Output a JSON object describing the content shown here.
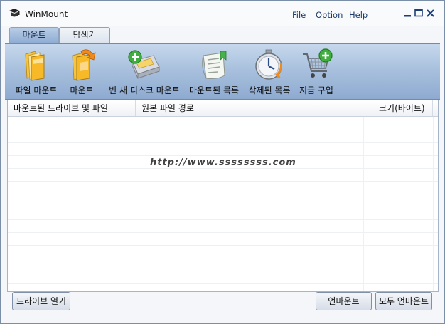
{
  "window": {
    "title": "WinMount"
  },
  "menu": [
    {
      "label": "File"
    },
    {
      "label": "Option"
    },
    {
      "label": "Help"
    }
  ],
  "tabs": [
    {
      "label": "마운트",
      "active": true
    },
    {
      "label": "탐색기",
      "active": false
    }
  ],
  "toolbar": {
    "items": [
      {
        "label": "파일 마운트",
        "icon": "folder-mount-icon"
      },
      {
        "label": "마운트",
        "icon": "folder-orange-arrow-icon"
      },
      {
        "label": "빈 새 디스크 마운트",
        "icon": "new-disk-add-icon"
      },
      {
        "label": "마운트된 목록",
        "icon": "mounted-list-icon"
      },
      {
        "label": "삭제된 목록",
        "icon": "deleted-list-clock-icon"
      },
      {
        "label": "지금 구입",
        "icon": "shopping-cart-icon"
      }
    ]
  },
  "list": {
    "columns": [
      {
        "label": "마운트된 드라이브 및 파일"
      },
      {
        "label": "원본 파일 경로"
      },
      {
        "label": "크기(바이트)"
      }
    ],
    "rows": []
  },
  "watermark": "http://www.ssssssss.com",
  "buttons": {
    "open_drive": "드라이브 열기",
    "unmount": "언마운트",
    "unmount_all": "모두 언마운트"
  },
  "colors": {
    "accent": "#8eaad0",
    "title_text": "#1a3a6a"
  }
}
